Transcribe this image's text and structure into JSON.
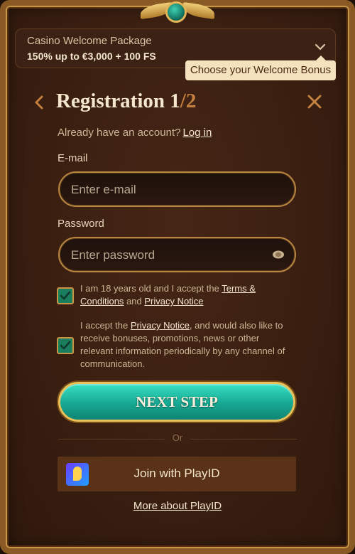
{
  "bonus": {
    "title": "Casino Welcome Package",
    "value": "150% up to €3,000 + 100 FS",
    "tooltip": "Choose your Welcome Bonus"
  },
  "header": {
    "title": "Registration",
    "step_current": "1",
    "step_separator": "/",
    "step_total": "2"
  },
  "login": {
    "prompt": "Already have an account?",
    "link": "Log in"
  },
  "form": {
    "email_label": "E-mail",
    "email_placeholder": "Enter e-mail",
    "password_label": "Password",
    "password_placeholder": "Enter password"
  },
  "consents": {
    "age": {
      "checked": true,
      "text_before": "I am 18 years old and I accept the",
      "terms_link": "Terms & Conditions",
      "text_and": "and",
      "privacy_link": "Privacy Notice"
    },
    "marketing": {
      "checked": true,
      "text_before": "I accept the",
      "privacy_link": "Privacy Notice",
      "text_after": ", and would also like to receive bonuses, promotions, news or other relevant information periodically by any channel of communication."
    }
  },
  "actions": {
    "next_step": "NEXT STEP",
    "or": "Or",
    "playid": "Join with PlayID",
    "more_playid": "More about PlayID"
  },
  "colors": {
    "accent_teal": "#17a892",
    "gold": "#c89546",
    "background": "#3a1f11"
  }
}
